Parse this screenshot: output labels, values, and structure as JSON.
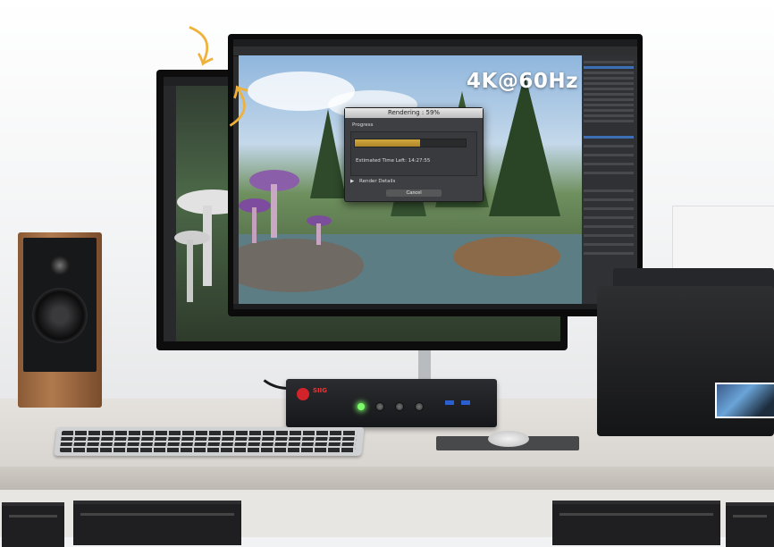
{
  "overlay": {
    "resolution_label": "4K@60Hz"
  },
  "render_dialog": {
    "title": "Rendering : 59%",
    "progress_label": "Progress",
    "progress_fraction": 0.59,
    "estimated_time": "Estimated Time Left: 14:27:55",
    "details_label": "Render Details",
    "cancel_label": "Cancel"
  },
  "kvm": {
    "brand": "SIIG",
    "led_color": "#7dff6a"
  },
  "colors": {
    "progress_fill": "#c79a33",
    "arrow": "#f0b13a",
    "kvm_accent": "#d3232a"
  }
}
